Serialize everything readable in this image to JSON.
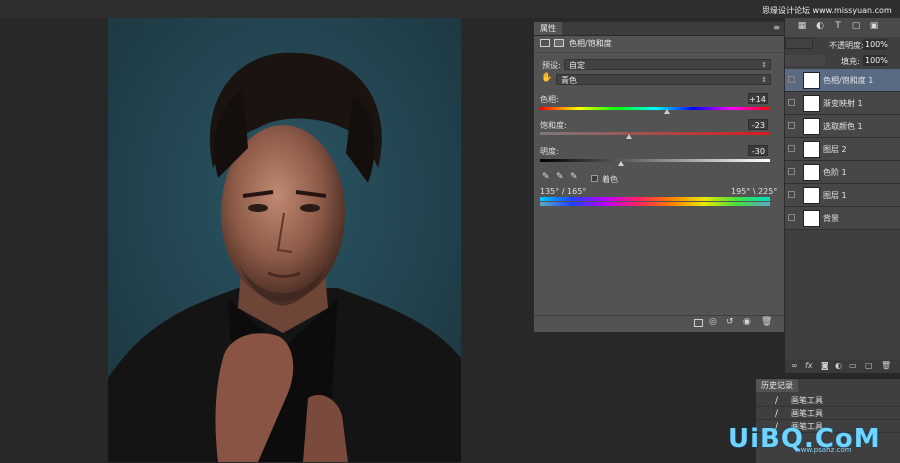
{
  "watermark_top": "思缘设计论坛 www.missyuan.com",
  "properties": {
    "tab": "属性",
    "adjustment_title": "色相/饱和度",
    "preset_label": "预设:",
    "preset_value": "自定",
    "channel_value": "青色",
    "hue_label": "色相:",
    "hue_value": "+14",
    "saturation_label": "饱和度:",
    "saturation_value": "-23",
    "lightness_label": "明度:",
    "lightness_value": "-30",
    "colorize_label": "着色",
    "range_left": "135° / 165°",
    "range_right": "195° \\ 225°",
    "hue_fraction": 0.55,
    "saturation_fraction": 0.385,
    "lightness_fraction": 0.35
  },
  "layers": {
    "opacity_label": "不透明度:",
    "opacity_value": "100%",
    "fill_label": "填充:",
    "fill_value": "100%",
    "items": [
      {
        "name": "色相/饱和度 1",
        "selected": true
      },
      {
        "name": "渐变映射 1",
        "selected": false
      },
      {
        "name": "选取颜色 1",
        "selected": false
      },
      {
        "name": "图层 2",
        "selected": false
      },
      {
        "name": "色阶 1",
        "selected": false
      },
      {
        "name": "图层 1",
        "selected": false
      },
      {
        "name": "背景",
        "selected": false
      }
    ]
  },
  "history": {
    "tab": "历史记录",
    "items": [
      "画笔工具",
      "画笔工具",
      "画笔工具"
    ]
  },
  "logo": {
    "text": "UiBQ.CoM",
    "url": "www.psahz.com"
  }
}
